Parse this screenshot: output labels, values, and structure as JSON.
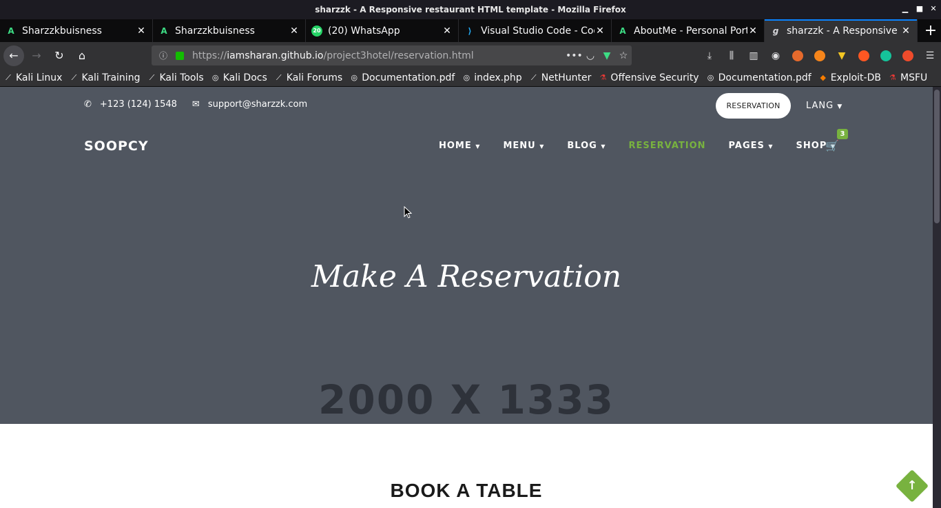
{
  "window": {
    "title": "sharzzk - A Responsive restaurant HTML template - Mozilla Firefox",
    "controls": [
      "minimize-icon",
      "maximize-icon",
      "close-icon"
    ]
  },
  "tabs": [
    {
      "label": "Sharzzkbuisness",
      "icon": "android-studio-icon",
      "color": "#3ddc84",
      "active": false
    },
    {
      "label": "Sharzzkbuisness",
      "icon": "android-studio-icon",
      "color": "#3ddc84",
      "active": false
    },
    {
      "label": "(20) WhatsApp",
      "icon": "whatsapp-icon",
      "color": "#25d366",
      "active": false
    },
    {
      "label": "Visual Studio Code - Cod",
      "icon": "vscode-icon",
      "color": "#23a9f2",
      "active": false
    },
    {
      "label": "AboutMe - Personal Port",
      "icon": "android-studio-icon",
      "color": "#3ddc84",
      "active": false
    },
    {
      "label": "sharzzk - A Responsive r",
      "icon": "site-icon",
      "color": "#ffffff",
      "active": true
    }
  ],
  "navbar": {
    "url_prefix": "https://",
    "url_host": "iamsharan.github.io",
    "url_path": "/project3hotel/reservation.html",
    "page_actions": "•••"
  },
  "bookmarks": [
    {
      "label": "Kali Linux",
      "icon": "kali-icon"
    },
    {
      "label": "Kali Training",
      "icon": "kali-icon"
    },
    {
      "label": "Kali Tools",
      "icon": "kali-icon"
    },
    {
      "label": "Kali Docs",
      "icon": "globe-icon"
    },
    {
      "label": "Kali Forums",
      "icon": "kali-icon"
    },
    {
      "label": "Documentation.pdf",
      "icon": "globe-icon"
    },
    {
      "label": "index.php",
      "icon": "globe-icon"
    },
    {
      "label": "NetHunter",
      "icon": "kali-icon"
    },
    {
      "label": "Offensive Security",
      "icon": "offsec-icon"
    },
    {
      "label": "Documentation.pdf",
      "icon": "globe-icon"
    },
    {
      "label": "Exploit-DB",
      "icon": "exploitdb-icon"
    },
    {
      "label": "MSFU",
      "icon": "offsec-icon"
    }
  ],
  "site": {
    "phone": "+123 (124) 1548",
    "email": "support@sharzzk.com",
    "reservation_button": "RESERVATION",
    "lang": "LANG",
    "logo": "SOOPCY",
    "nav": [
      {
        "label": "HOME",
        "dropdown": true,
        "active": false
      },
      {
        "label": "MENU",
        "dropdown": true,
        "active": false
      },
      {
        "label": "BLOG",
        "dropdown": true,
        "active": false
      },
      {
        "label": "RESERVATION",
        "dropdown": false,
        "active": true
      },
      {
        "label": "PAGES",
        "dropdown": true,
        "active": false
      },
      {
        "label": "SHOP",
        "dropdown": true,
        "active": false
      }
    ],
    "cart_count": "3",
    "hero_title": "Make A Reservation",
    "hero_placeholder": "2000 X 1333",
    "section_title": "BOOK A TABLE",
    "accent_color": "#78b23f"
  }
}
